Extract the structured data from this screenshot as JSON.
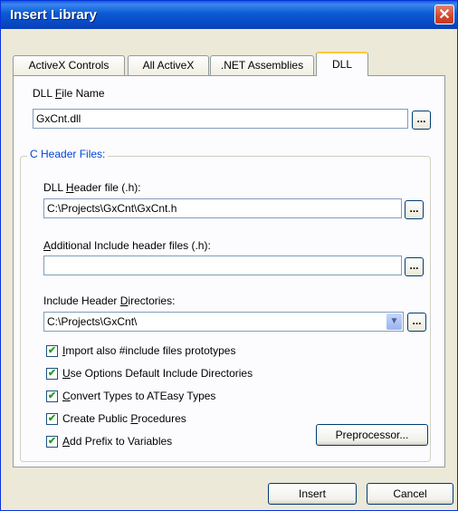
{
  "window": {
    "title": "Insert Library",
    "close_glyph": "✕"
  },
  "tabs": [
    {
      "label": "ActiveX Controls",
      "active": false
    },
    {
      "label": "All ActiveX",
      "active": false
    },
    {
      "label": ".NET Assemblies",
      "active": false
    },
    {
      "label": "DLL",
      "active": true
    }
  ],
  "dll_file": {
    "label_pre": "DLL ",
    "label_u": "F",
    "label_post": "ile Name",
    "value": "GxCnt.dll",
    "browse": "..."
  },
  "header_group": {
    "title": "C Header Files:"
  },
  "dll_header": {
    "label_pre": "DLL ",
    "label_u": "H",
    "label_post": "eader file (.h):",
    "value": "C:\\Projects\\GxCnt\\GxCnt.h",
    "browse": "..."
  },
  "additional": {
    "label_pre": "",
    "label_u": "A",
    "label_post": "dditional Include header files (.h):",
    "value": "",
    "browse": "..."
  },
  "include_dirs": {
    "label_pre": "Include Header ",
    "label_u": "D",
    "label_post": "irectories:",
    "value": "C:\\Projects\\GxCnt\\",
    "browse": "...",
    "dropdown_glyph": "▼"
  },
  "options": [
    {
      "pre": "",
      "u": "I",
      "post": "mport also #include files prototypes",
      "checked": true
    },
    {
      "pre": "",
      "u": "U",
      "post": "se Options Default Include Directories",
      "checked": true
    },
    {
      "pre": "",
      "u": "C",
      "post": "onvert Types to ATEasy Types",
      "checked": true
    },
    {
      "pre": "Create Public ",
      "u": "P",
      "post": "rocedures",
      "checked": true
    },
    {
      "pre": "",
      "u": "A",
      "post": "dd Prefix to Variables",
      "checked": true
    }
  ],
  "check_glyph": "✔",
  "buttons": {
    "preprocessor": "Preprocessor...",
    "insert": "Insert",
    "cancel": "Cancel"
  }
}
